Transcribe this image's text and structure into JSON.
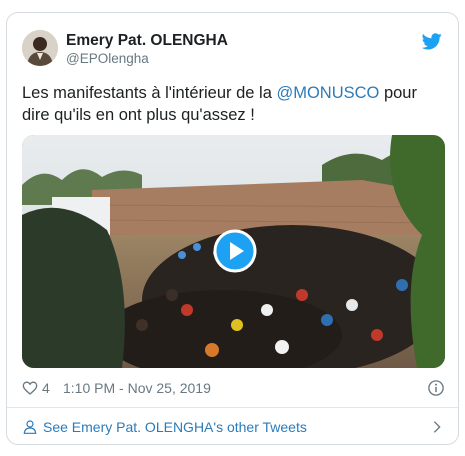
{
  "author": {
    "name": "Emery Pat. OLENGHA",
    "handle": "@EPOlengha"
  },
  "tweet": {
    "text_before": "Les manifestants à l'intérieur de la ",
    "mention": "@MONUSCO",
    "text_after": " pour dire qu'ils en ont plus qu'assez !"
  },
  "footer": {
    "like_count": "4",
    "timestamp": "1:10 PM - Nov 25, 2019"
  },
  "other_tweets_label": "See Emery Pat. OLENGHA's other Tweets",
  "colors": {
    "link": "#2b7bb9",
    "muted": "#697882",
    "twitter_blue": "#1da1f2"
  },
  "icons": [
    "twitter-bird-icon",
    "play-icon",
    "heart-icon",
    "info-icon",
    "person-icon",
    "chevron-right-icon"
  ]
}
